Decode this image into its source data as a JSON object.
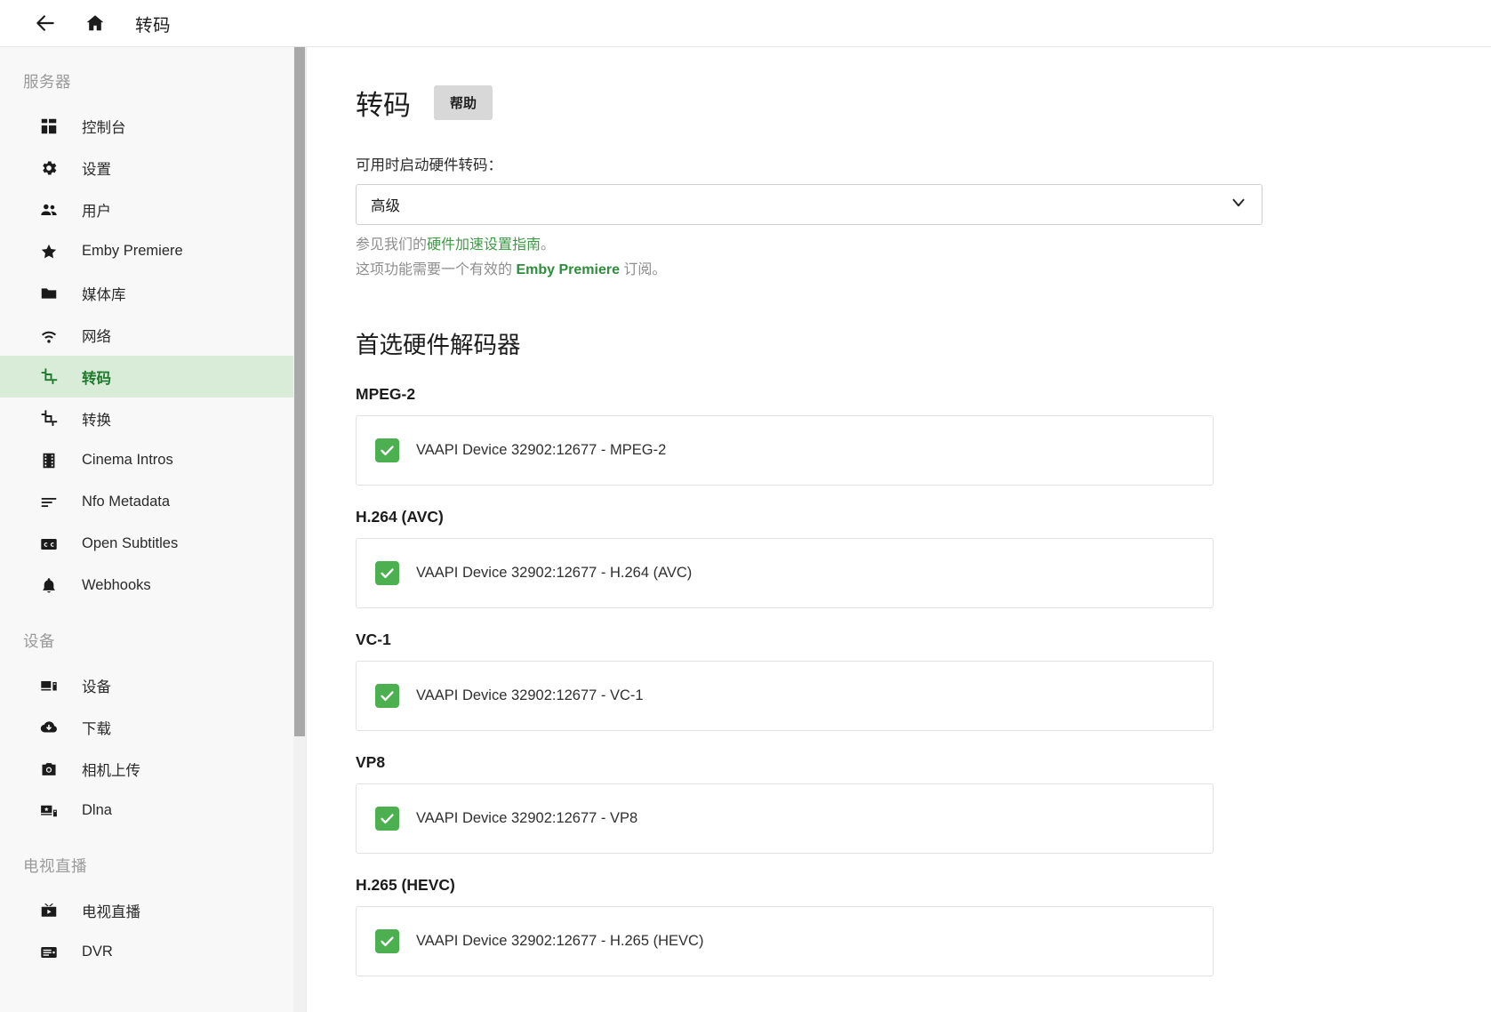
{
  "topbar": {
    "back_icon": "arrow-left-icon",
    "home_icon": "home-icon",
    "title": "转码"
  },
  "sidebar": {
    "groups": [
      {
        "title": "服务器",
        "items": [
          {
            "label": "控制台",
            "icon": "dashboard-icon",
            "active": false
          },
          {
            "label": "设置",
            "icon": "gear-icon",
            "active": false
          },
          {
            "label": "用户",
            "icon": "users-icon",
            "active": false
          },
          {
            "label": "Emby Premiere",
            "icon": "star-icon",
            "active": false
          },
          {
            "label": "媒体库",
            "icon": "folder-icon",
            "active": false
          },
          {
            "label": "网络",
            "icon": "wifi-icon",
            "active": false
          },
          {
            "label": "转码",
            "icon": "transcode-icon",
            "active": true
          },
          {
            "label": "转换",
            "icon": "convert-icon",
            "active": false
          },
          {
            "label": "Cinema Intros",
            "icon": "film-icon",
            "active": false
          },
          {
            "label": "Nfo Metadata",
            "icon": "list-icon",
            "active": false
          },
          {
            "label": "Open Subtitles",
            "icon": "cc-icon",
            "active": false
          },
          {
            "label": "Webhooks",
            "icon": "bell-icon",
            "active": false
          }
        ]
      },
      {
        "title": "设备",
        "items": [
          {
            "label": "设备",
            "icon": "devices-icon",
            "active": false
          },
          {
            "label": "下载",
            "icon": "cloud-download-icon",
            "active": false
          },
          {
            "label": "相机上传",
            "icon": "camera-icon",
            "active": false
          },
          {
            "label": "Dlna",
            "icon": "dlna-icon",
            "active": false
          }
        ]
      },
      {
        "title": "电视直播",
        "items": [
          {
            "label": "电视直播",
            "icon": "live-tv-icon",
            "active": false
          },
          {
            "label": "DVR",
            "icon": "dvr-icon",
            "active": false
          }
        ]
      }
    ]
  },
  "main": {
    "title": "转码",
    "help_label": "帮助",
    "hwa_field_label": "可用时启动硬件转码：",
    "hwa_selected_value": "高级",
    "hwa_options": [
      "高级"
    ],
    "helper_line_1_prefix": "参见我们的",
    "helper_line_1_link": "硬件加速设置指南",
    "helper_line_1_suffix": "。",
    "helper_line_2_prefix": "这项功能需要一个有效的 ",
    "helper_line_2_bold": "Emby Premiere",
    "helper_line_2_suffix": " 订阅。",
    "decoders_heading": "首选硬件解码器",
    "decoders": [
      {
        "codec": "MPEG-2",
        "device_label": "VAAPI Device 32902:12677 - MPEG-2",
        "checked": true
      },
      {
        "codec": "H.264 (AVC)",
        "device_label": "VAAPI Device 32902:12677 - H.264 (AVC)",
        "checked": true
      },
      {
        "codec": "VC-1",
        "device_label": "VAAPI Device 32902:12677 - VC-1",
        "checked": true
      },
      {
        "codec": "VP8",
        "device_label": "VAAPI Device 32902:12677 - VP8",
        "checked": true
      },
      {
        "codec": "H.265 (HEVC)",
        "device_label": "VAAPI Device 32902:12677 - H.265 (HEVC)",
        "checked": true
      }
    ]
  },
  "colors": {
    "accent_green": "#4caf50",
    "link_green": "#3d9b46",
    "active_bg": "#d8ecd7",
    "active_text": "#1f7a2e",
    "help_btn_bg": "#d8d8d8"
  }
}
